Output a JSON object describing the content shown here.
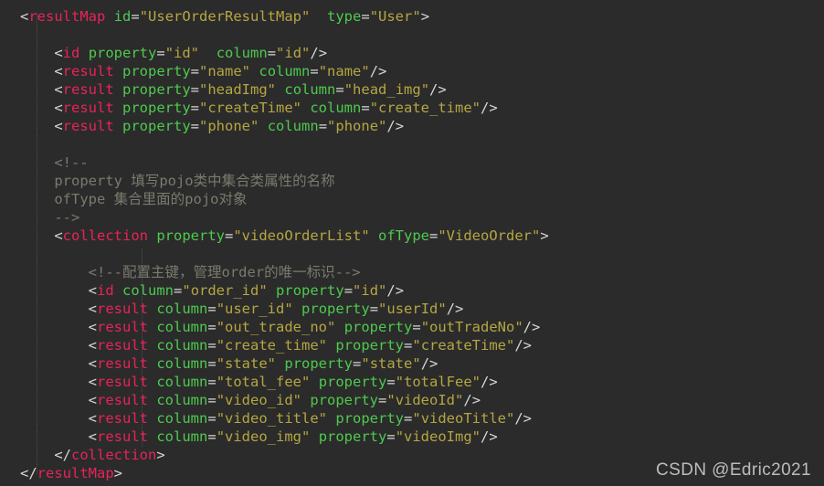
{
  "editor": {
    "background_color": "#2b2b2b",
    "language": "xml",
    "colors": {
      "punctuation": "#d6d6d6",
      "tag_name": "#e8235a",
      "attribute_name": "#4ec94e",
      "attribute_value": "#b5a642",
      "comment": "#7a7a6e",
      "indent_guide": "#4e4e46"
    },
    "indent_guides": [
      40,
      155
    ],
    "lines": [
      {
        "indent": 0,
        "tokens": [
          {
            "t": "pn",
            "v": "<"
          },
          {
            "t": "tag",
            "v": "resultMap"
          },
          {
            "t": "pn",
            "v": " "
          },
          {
            "t": "at",
            "v": "id"
          },
          {
            "t": "pn",
            "v": "="
          },
          {
            "t": "va",
            "v": "\"UserOrderResultMap\""
          },
          {
            "t": "pn",
            "v": "  "
          },
          {
            "t": "at",
            "v": "type"
          },
          {
            "t": "pn",
            "v": "="
          },
          {
            "t": "va",
            "v": "\"User\""
          },
          {
            "t": "pn",
            "v": ">"
          }
        ]
      },
      {
        "indent": 0,
        "tokens": []
      },
      {
        "indent": 4,
        "tokens": [
          {
            "t": "pn",
            "v": "<"
          },
          {
            "t": "tag",
            "v": "id"
          },
          {
            "t": "pn",
            "v": " "
          },
          {
            "t": "at",
            "v": "property"
          },
          {
            "t": "pn",
            "v": "="
          },
          {
            "t": "va",
            "v": "\"id\""
          },
          {
            "t": "pn",
            "v": "  "
          },
          {
            "t": "at",
            "v": "column"
          },
          {
            "t": "pn",
            "v": "="
          },
          {
            "t": "va",
            "v": "\"id\""
          },
          {
            "t": "pn",
            "v": "/>"
          }
        ]
      },
      {
        "indent": 4,
        "tokens": [
          {
            "t": "pn",
            "v": "<"
          },
          {
            "t": "tag",
            "v": "result"
          },
          {
            "t": "pn",
            "v": " "
          },
          {
            "t": "at",
            "v": "property"
          },
          {
            "t": "pn",
            "v": "="
          },
          {
            "t": "va",
            "v": "\"name\""
          },
          {
            "t": "pn",
            "v": " "
          },
          {
            "t": "at",
            "v": "column"
          },
          {
            "t": "pn",
            "v": "="
          },
          {
            "t": "va",
            "v": "\"name\""
          },
          {
            "t": "pn",
            "v": "/>"
          }
        ]
      },
      {
        "indent": 4,
        "tokens": [
          {
            "t": "pn",
            "v": "<"
          },
          {
            "t": "tag",
            "v": "result"
          },
          {
            "t": "pn",
            "v": " "
          },
          {
            "t": "at",
            "v": "property"
          },
          {
            "t": "pn",
            "v": "="
          },
          {
            "t": "va",
            "v": "\"headImg\""
          },
          {
            "t": "pn",
            "v": " "
          },
          {
            "t": "at",
            "v": "column"
          },
          {
            "t": "pn",
            "v": "="
          },
          {
            "t": "va",
            "v": "\"head_img\""
          },
          {
            "t": "pn",
            "v": "/>"
          }
        ]
      },
      {
        "indent": 4,
        "tokens": [
          {
            "t": "pn",
            "v": "<"
          },
          {
            "t": "tag",
            "v": "result"
          },
          {
            "t": "pn",
            "v": " "
          },
          {
            "t": "at",
            "v": "property"
          },
          {
            "t": "pn",
            "v": "="
          },
          {
            "t": "va",
            "v": "\"createTime\""
          },
          {
            "t": "pn",
            "v": " "
          },
          {
            "t": "at",
            "v": "column"
          },
          {
            "t": "pn",
            "v": "="
          },
          {
            "t": "va",
            "v": "\"create_time\""
          },
          {
            "t": "pn",
            "v": "/>"
          }
        ]
      },
      {
        "indent": 4,
        "tokens": [
          {
            "t": "pn",
            "v": "<"
          },
          {
            "t": "tag",
            "v": "result"
          },
          {
            "t": "pn",
            "v": " "
          },
          {
            "t": "at",
            "v": "property"
          },
          {
            "t": "pn",
            "v": "="
          },
          {
            "t": "va",
            "v": "\"phone\""
          },
          {
            "t": "pn",
            "v": " "
          },
          {
            "t": "at",
            "v": "column"
          },
          {
            "t": "pn",
            "v": "="
          },
          {
            "t": "va",
            "v": "\"phone\""
          },
          {
            "t": "pn",
            "v": "/>"
          }
        ]
      },
      {
        "indent": 0,
        "tokens": []
      },
      {
        "indent": 4,
        "tokens": [
          {
            "t": "cm",
            "v": "<!--"
          }
        ]
      },
      {
        "indent": 4,
        "tokens": [
          {
            "t": "cm",
            "v": "property 填写pojo类中集合类属性的名称"
          }
        ]
      },
      {
        "indent": 4,
        "tokens": [
          {
            "t": "cm",
            "v": "ofType 集合里面的pojo对象"
          }
        ]
      },
      {
        "indent": 4,
        "tokens": [
          {
            "t": "cm",
            "v": "-->"
          }
        ]
      },
      {
        "indent": 4,
        "tokens": [
          {
            "t": "pn",
            "v": "<"
          },
          {
            "t": "tag",
            "v": "collection"
          },
          {
            "t": "pn",
            "v": " "
          },
          {
            "t": "at",
            "v": "property"
          },
          {
            "t": "pn",
            "v": "="
          },
          {
            "t": "va",
            "v": "\"videoOrderList\""
          },
          {
            "t": "pn",
            "v": " "
          },
          {
            "t": "at",
            "v": "ofType"
          },
          {
            "t": "pn",
            "v": "="
          },
          {
            "t": "va",
            "v": "\"VideoOrder\""
          },
          {
            "t": "pn",
            "v": ">"
          }
        ]
      },
      {
        "indent": 0,
        "tokens": []
      },
      {
        "indent": 8,
        "tokens": [
          {
            "t": "cm",
            "v": "<!--配置主键，管理order的唯一标识-->"
          }
        ]
      },
      {
        "indent": 8,
        "tokens": [
          {
            "t": "pn",
            "v": "<"
          },
          {
            "t": "tag",
            "v": "id"
          },
          {
            "t": "pn",
            "v": " "
          },
          {
            "t": "at",
            "v": "column"
          },
          {
            "t": "pn",
            "v": "="
          },
          {
            "t": "va",
            "v": "\"order_id\""
          },
          {
            "t": "pn",
            "v": " "
          },
          {
            "t": "at",
            "v": "property"
          },
          {
            "t": "pn",
            "v": "="
          },
          {
            "t": "va",
            "v": "\"id\""
          },
          {
            "t": "pn",
            "v": "/>"
          }
        ]
      },
      {
        "indent": 8,
        "tokens": [
          {
            "t": "pn",
            "v": "<"
          },
          {
            "t": "tag",
            "v": "result"
          },
          {
            "t": "pn",
            "v": " "
          },
          {
            "t": "at",
            "v": "column"
          },
          {
            "t": "pn",
            "v": "="
          },
          {
            "t": "va",
            "v": "\"user_id\""
          },
          {
            "t": "pn",
            "v": " "
          },
          {
            "t": "at",
            "v": "property"
          },
          {
            "t": "pn",
            "v": "="
          },
          {
            "t": "va",
            "v": "\"userId\""
          },
          {
            "t": "pn",
            "v": "/>"
          }
        ]
      },
      {
        "indent": 8,
        "tokens": [
          {
            "t": "pn",
            "v": "<"
          },
          {
            "t": "tag",
            "v": "result"
          },
          {
            "t": "pn",
            "v": " "
          },
          {
            "t": "at",
            "v": "column"
          },
          {
            "t": "pn",
            "v": "="
          },
          {
            "t": "va",
            "v": "\"out_trade_no\""
          },
          {
            "t": "pn",
            "v": " "
          },
          {
            "t": "at",
            "v": "property"
          },
          {
            "t": "pn",
            "v": "="
          },
          {
            "t": "va",
            "v": "\"outTradeNo\""
          },
          {
            "t": "pn",
            "v": "/>"
          }
        ]
      },
      {
        "indent": 8,
        "tokens": [
          {
            "t": "pn",
            "v": "<"
          },
          {
            "t": "tag",
            "v": "result"
          },
          {
            "t": "pn",
            "v": " "
          },
          {
            "t": "at",
            "v": "column"
          },
          {
            "t": "pn",
            "v": "="
          },
          {
            "t": "va",
            "v": "\"create_time\""
          },
          {
            "t": "pn",
            "v": " "
          },
          {
            "t": "at",
            "v": "property"
          },
          {
            "t": "pn",
            "v": "="
          },
          {
            "t": "va",
            "v": "\"createTime\""
          },
          {
            "t": "pn",
            "v": "/>"
          }
        ]
      },
      {
        "indent": 8,
        "tokens": [
          {
            "t": "pn",
            "v": "<"
          },
          {
            "t": "tag",
            "v": "result"
          },
          {
            "t": "pn",
            "v": " "
          },
          {
            "t": "at",
            "v": "column"
          },
          {
            "t": "pn",
            "v": "="
          },
          {
            "t": "va",
            "v": "\"state\""
          },
          {
            "t": "pn",
            "v": " "
          },
          {
            "t": "at",
            "v": "property"
          },
          {
            "t": "pn",
            "v": "="
          },
          {
            "t": "va",
            "v": "\"state\""
          },
          {
            "t": "pn",
            "v": "/>"
          }
        ]
      },
      {
        "indent": 8,
        "tokens": [
          {
            "t": "pn",
            "v": "<"
          },
          {
            "t": "tag",
            "v": "result"
          },
          {
            "t": "pn",
            "v": " "
          },
          {
            "t": "at",
            "v": "column"
          },
          {
            "t": "pn",
            "v": "="
          },
          {
            "t": "va",
            "v": "\"total_fee\""
          },
          {
            "t": "pn",
            "v": " "
          },
          {
            "t": "at",
            "v": "property"
          },
          {
            "t": "pn",
            "v": "="
          },
          {
            "t": "va",
            "v": "\"totalFee\""
          },
          {
            "t": "pn",
            "v": "/>"
          }
        ]
      },
      {
        "indent": 8,
        "tokens": [
          {
            "t": "pn",
            "v": "<"
          },
          {
            "t": "tag",
            "v": "result"
          },
          {
            "t": "pn",
            "v": " "
          },
          {
            "t": "at",
            "v": "column"
          },
          {
            "t": "pn",
            "v": "="
          },
          {
            "t": "va",
            "v": "\"video_id\""
          },
          {
            "t": "pn",
            "v": " "
          },
          {
            "t": "at",
            "v": "property"
          },
          {
            "t": "pn",
            "v": "="
          },
          {
            "t": "va",
            "v": "\"videoId\""
          },
          {
            "t": "pn",
            "v": "/>"
          }
        ]
      },
      {
        "indent": 8,
        "tokens": [
          {
            "t": "pn",
            "v": "<"
          },
          {
            "t": "tag",
            "v": "result"
          },
          {
            "t": "pn",
            "v": " "
          },
          {
            "t": "at",
            "v": "column"
          },
          {
            "t": "pn",
            "v": "="
          },
          {
            "t": "va",
            "v": "\"video_title\""
          },
          {
            "t": "pn",
            "v": " "
          },
          {
            "t": "at",
            "v": "property"
          },
          {
            "t": "pn",
            "v": "="
          },
          {
            "t": "va",
            "v": "\"videoTitle\""
          },
          {
            "t": "pn",
            "v": "/>"
          }
        ]
      },
      {
        "indent": 8,
        "tokens": [
          {
            "t": "pn",
            "v": "<"
          },
          {
            "t": "tag",
            "v": "result"
          },
          {
            "t": "pn",
            "v": " "
          },
          {
            "t": "at",
            "v": "column"
          },
          {
            "t": "pn",
            "v": "="
          },
          {
            "t": "va",
            "v": "\"video_img\""
          },
          {
            "t": "pn",
            "v": " "
          },
          {
            "t": "at",
            "v": "property"
          },
          {
            "t": "pn",
            "v": "="
          },
          {
            "t": "va",
            "v": "\"videoImg\""
          },
          {
            "t": "pn",
            "v": "/>"
          }
        ]
      },
      {
        "indent": 4,
        "tokens": [
          {
            "t": "pn",
            "v": "</"
          },
          {
            "t": "tag",
            "v": "collection"
          },
          {
            "t": "pn",
            "v": ">"
          }
        ]
      },
      {
        "indent": 0,
        "tokens": [
          {
            "t": "pn",
            "v": "</"
          },
          {
            "t": "tag",
            "v": "resultMap"
          },
          {
            "t": "pn",
            "v": ">"
          }
        ]
      }
    ]
  },
  "watermark": {
    "text": "CSDN @Edric2021",
    "color": "#c9c9c9"
  }
}
